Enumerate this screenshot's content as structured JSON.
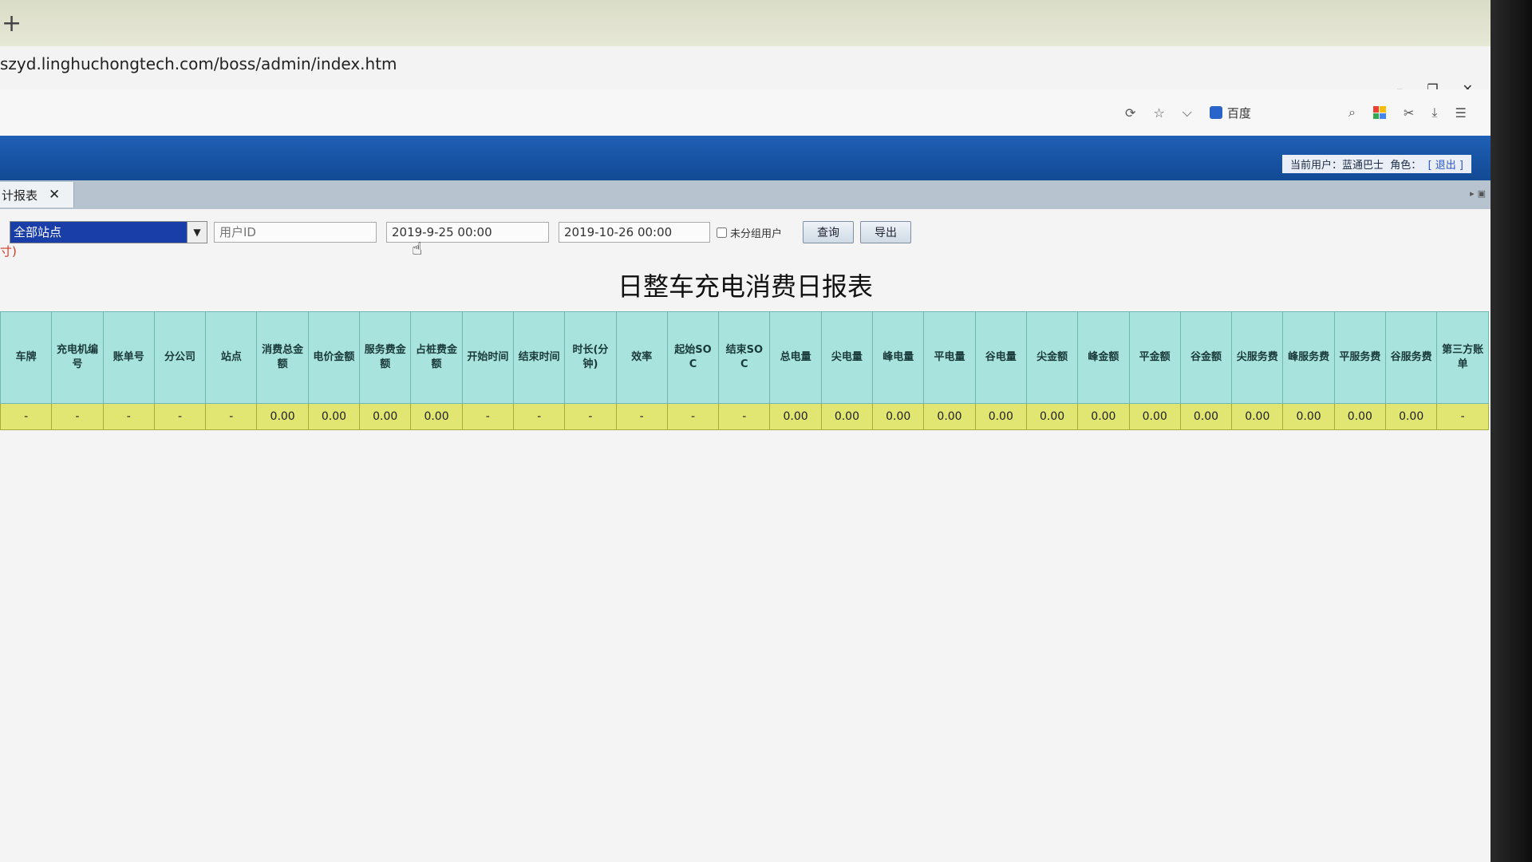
{
  "browser": {
    "new_tab_symbol": "+",
    "url": "szyd.linghuchongtech.com/boss/admin/index.htm",
    "window_controls": [
      "–",
      "❐",
      "✕"
    ],
    "search_engine_label": "百度"
  },
  "header": {
    "current_user_label": "当前用户：",
    "current_user": "蓝通巴士",
    "role_label": "角色：",
    "logout_label": "[ 退出 ]"
  },
  "tab": {
    "label": "计报表",
    "close_symbol": "✕"
  },
  "filters": {
    "station": "全部站点",
    "user_id_placeholder": "用户ID",
    "start_time": "2019-9-25 00:00",
    "end_time": "2019-10-26 00:00",
    "ungrouped_label": "未分组用户",
    "query_label": "查询",
    "export_label": "导出"
  },
  "note": "寸)",
  "report": {
    "title": "日整车充电消费日报表",
    "columns": [
      "车牌",
      "充电机编号",
      "账单号",
      "分公司",
      "站点",
      "消费总金额",
      "电价金额",
      "服务费金额",
      "占桩费金额",
      "开始时间",
      "结束时间",
      "时长(分钟)",
      "效率",
      "起始SOC",
      "结束SOC",
      "总电量",
      "尖电量",
      "峰电量",
      "平电量",
      "谷电量",
      "尖金额",
      "峰金额",
      "平金额",
      "谷金额",
      "尖服务费",
      "峰服务费",
      "平服务费",
      "谷服务费",
      "第三方账单"
    ],
    "rows": [
      [
        "-",
        "-",
        "-",
        "-",
        "-",
        "0.00",
        "0.00",
        "0.00",
        "0.00",
        "-",
        "-",
        "-",
        "-",
        "-",
        "-",
        "0.00",
        "0.00",
        "0.00",
        "0.00",
        "0.00",
        "0.00",
        "0.00",
        "0.00",
        "0.00",
        "0.00",
        "0.00",
        "0.00",
        "0.00",
        "-"
      ]
    ]
  }
}
